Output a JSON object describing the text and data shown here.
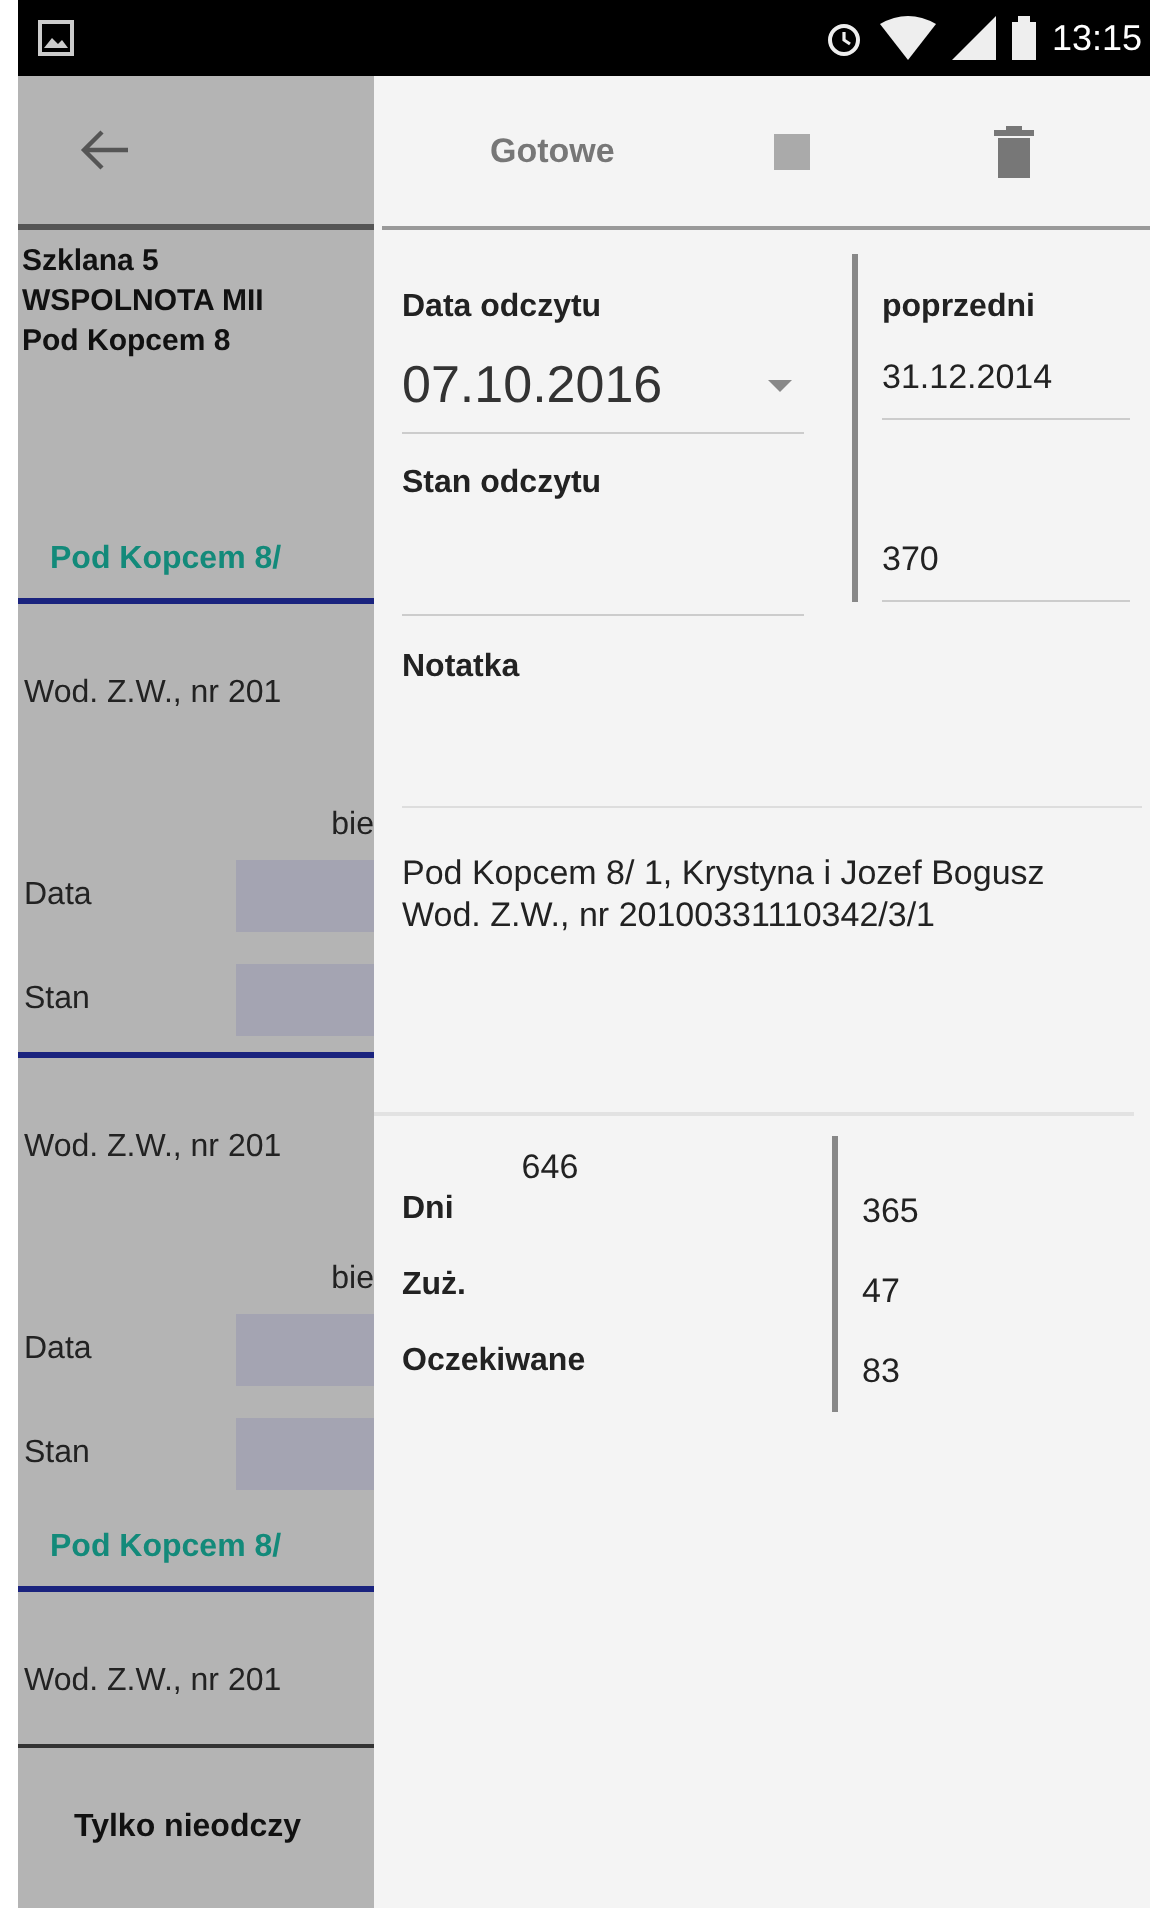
{
  "status_bar": {
    "time": "13:15"
  },
  "background_list": {
    "header": [
      "Szklana 5",
      "WSPOLNOTA MII",
      "Pod Kopcem 8"
    ],
    "groups": [
      {
        "title": "Pod Kopcem 8/",
        "meters": [
          {
            "name": "Wod. Z.W., nr 201",
            "column_label": "bie",
            "fields": [
              "Data",
              "Stan"
            ]
          },
          {
            "name": "Wod. Z.W., nr 201",
            "column_label": "bie",
            "fields": [
              "Data",
              "Stan"
            ]
          }
        ]
      },
      {
        "title": "Pod Kopcem 8/",
        "meters": [
          {
            "name": "Wod. Z.W., nr 201"
          }
        ]
      }
    ],
    "footer": "Tylko nieodczy"
  },
  "toolbar": {
    "done": "Gotowe"
  },
  "form": {
    "date_label": "Data odczytu",
    "date_value": "07.10.2016",
    "reading_label": "Stan odczytu",
    "previous_label": "poprzedni",
    "previous_date": "31.12.2014",
    "previous_reading": "370",
    "note_label": "Notatka",
    "info": [
      "Pod Kopcem 8/  1, Krystyna i Jozef Bogusz",
      "Wod. Z.W., nr 20100331110342/3/1"
    ]
  },
  "stats": {
    "days_current": "646",
    "rows": [
      {
        "label": "Dni",
        "value": "365"
      },
      {
        "label": "Zuż.",
        "value": "47"
      },
      {
        "label": "Oczekiwane",
        "value": "83"
      }
    ]
  }
}
